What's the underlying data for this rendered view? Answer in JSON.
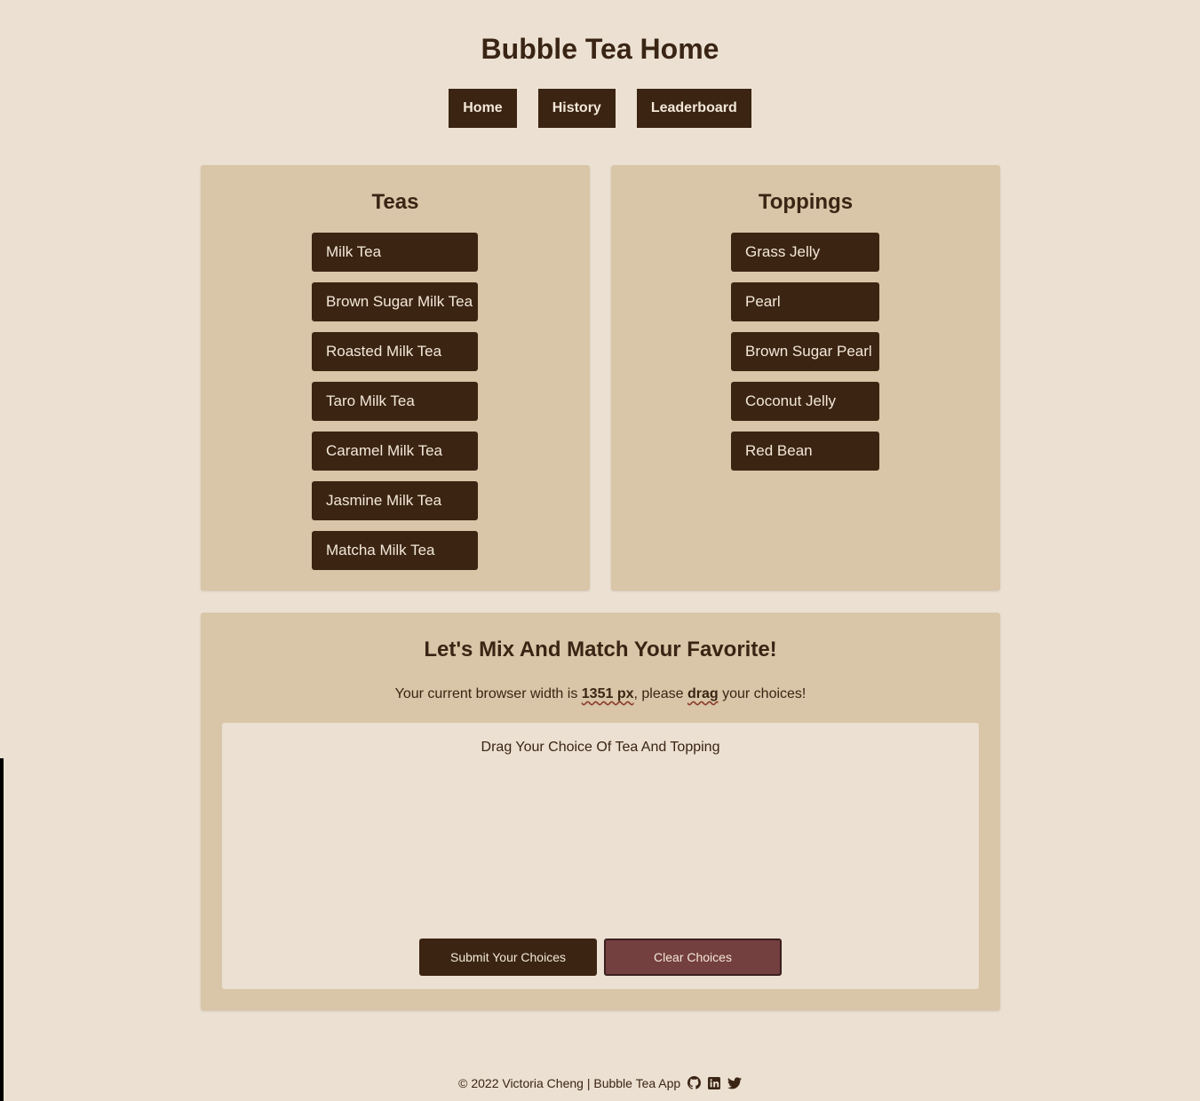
{
  "page": {
    "title": "Bubble Tea Home"
  },
  "nav": {
    "items": [
      "Home",
      "History",
      "Leaderboard"
    ]
  },
  "teas": {
    "heading": "Teas",
    "items": [
      "Milk Tea",
      "Brown Sugar Milk Tea",
      "Roasted Milk Tea",
      "Taro Milk Tea",
      "Caramel Milk Tea",
      "Jasmine Milk Tea",
      "Matcha Milk Tea"
    ]
  },
  "toppings": {
    "heading": "Toppings",
    "items": [
      "Grass Jelly",
      "Pearl",
      "Brown Sugar Pearl",
      "Coconut Jelly",
      "Red Bean"
    ]
  },
  "mix": {
    "title": "Let's Mix And Match Your Favorite!",
    "width_prefix": "Your current browser width is ",
    "width_value": "1351 px",
    "width_mid": ", please ",
    "width_drag": "drag",
    "width_suffix": " your choices!",
    "drop_label": "Drag Your Choice Of Tea And Topping",
    "submit_label": "Submit Your Choices",
    "clear_label": "Clear Choices"
  },
  "footer": {
    "text": "© 2022 Victoria Cheng | Bubble Tea App"
  },
  "icons": [
    "github-icon",
    "linkedin-icon",
    "twitter-icon"
  ],
  "colors": {
    "background": "#ebe0d1",
    "panel": "#d9c5a7",
    "button": "#3b2412",
    "clear_button": "#743f3f",
    "text": "#3a2414"
  }
}
